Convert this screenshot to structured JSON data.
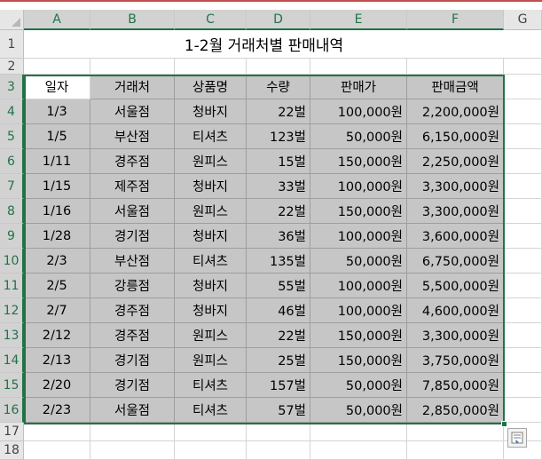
{
  "title": "1-2월 거래처별 판매내역",
  "columns": [
    "A",
    "B",
    "C",
    "D",
    "E",
    "F",
    "G"
  ],
  "rows": [
    "1",
    "2",
    "3",
    "4",
    "5",
    "6",
    "7",
    "8",
    "9",
    "10",
    "11",
    "12",
    "13",
    "14",
    "15",
    "16",
    "17",
    "18"
  ],
  "table": {
    "headers": [
      "일자",
      "거래처",
      "상품명",
      "수량",
      "판매가",
      "판매금액"
    ],
    "data": [
      [
        "1/3",
        "서울점",
        "청바지",
        "22벌",
        "100,000원",
        "2,200,000원"
      ],
      [
        "1/5",
        "부산점",
        "티셔츠",
        "123벌",
        "50,000원",
        "6,150,000원"
      ],
      [
        "1/11",
        "경주점",
        "원피스",
        "15벌",
        "150,000원",
        "2,250,000원"
      ],
      [
        "1/15",
        "제주점",
        "청바지",
        "33벌",
        "100,000원",
        "3,300,000원"
      ],
      [
        "1/16",
        "서울점",
        "원피스",
        "22벌",
        "150,000원",
        "3,300,000원"
      ],
      [
        "1/28",
        "경기점",
        "청바지",
        "36벌",
        "100,000원",
        "3,600,000원"
      ],
      [
        "2/3",
        "부산점",
        "티셔츠",
        "135벌",
        "50,000원",
        "6,750,000원"
      ],
      [
        "2/5",
        "강릉점",
        "청바지",
        "55벌",
        "100,000원",
        "5,500,000원"
      ],
      [
        "2/7",
        "경주점",
        "청바지",
        "46벌",
        "100,000원",
        "4,600,000원"
      ],
      [
        "2/12",
        "경주점",
        "원피스",
        "22벌",
        "150,000원",
        "3,300,000원"
      ],
      [
        "2/13",
        "경기점",
        "원피스",
        "25벌",
        "150,000원",
        "3,750,000원"
      ],
      [
        "2/20",
        "경기점",
        "티셔츠",
        "157벌",
        "50,000원",
        "7,850,000원"
      ],
      [
        "2/23",
        "서울점",
        "티셔츠",
        "57벌",
        "50,000원",
        "2,850,000원"
      ]
    ]
  },
  "colors": {
    "accent": "#217346",
    "selection_fill": "#c6c6c6",
    "header_bg": "#e6e6e6"
  },
  "icons": {
    "quick_analysis": "quick-analysis-icon",
    "select_all": "select-all-icon"
  }
}
